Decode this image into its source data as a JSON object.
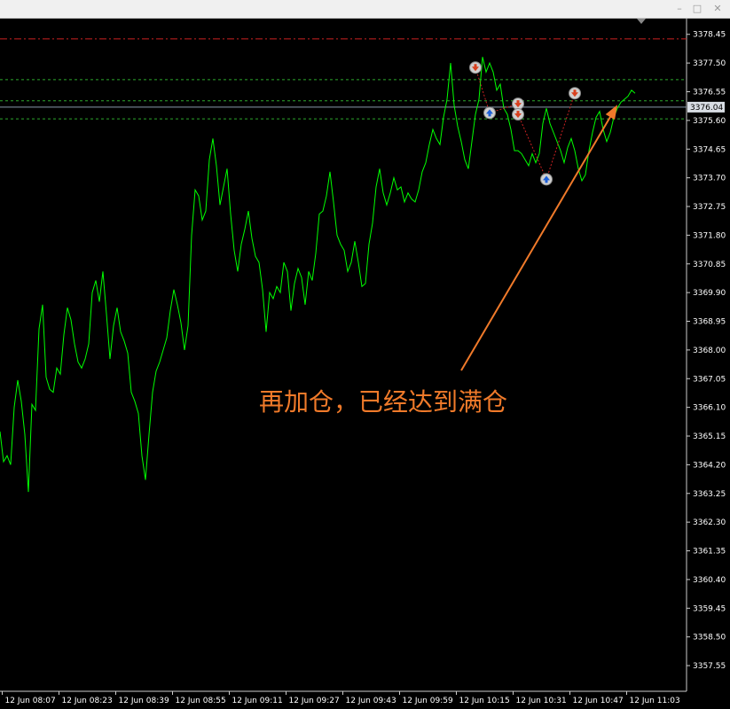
{
  "window": {
    "minimize_glyph": "–",
    "maximize_glyph": "□",
    "close_glyph": "✕"
  },
  "chart_data": {
    "type": "line",
    "title": "",
    "xlabel": "",
    "ylabel": "",
    "ylim": [
      3356.7,
      3379.0
    ],
    "y_ticks": [
      "3378.45",
      "3377.50",
      "3376.55",
      "3375.60",
      "3374.65",
      "3373.70",
      "3372.75",
      "3371.80",
      "3370.85",
      "3369.90",
      "3368.95",
      "3368.00",
      "3367.05",
      "3366.10",
      "3365.15",
      "3364.20",
      "3363.25",
      "3362.30",
      "3361.35",
      "3360.40",
      "3359.45",
      "3358.50",
      "3357.55"
    ],
    "x_ticks": [
      "12 Jun 08:07",
      "12 Jun 08:23",
      "12 Jun 08:39",
      "12 Jun 08:55",
      "12 Jun 09:11",
      "12 Jun 09:27",
      "12 Jun 09:43",
      "12 Jun 09:59",
      "12 Jun 10:15",
      "12 Jun 10:31",
      "12 Jun 10:47",
      "12 Jun 11:03"
    ],
    "current_price": "3376.04",
    "colors": {
      "line": "#00ff00",
      "level": "#2ea82e",
      "stop_level": "#cc2222",
      "arrow": "#f07a2a",
      "text": "#ffffff"
    },
    "levels": [
      {
        "price": 3378.3,
        "style": "dash-dot",
        "color": "#cc2222"
      },
      {
        "price": 3376.95,
        "style": "dashed",
        "color": "#2ea82e"
      },
      {
        "price": 3376.25,
        "style": "dashed",
        "color": "#2ea82e"
      },
      {
        "price": 3375.65,
        "style": "dashed",
        "color": "#2ea82e"
      }
    ],
    "series": [
      {
        "x_index": [
          0,
          1,
          2,
          3,
          4,
          5,
          6,
          7,
          8,
          9,
          10,
          11,
          12,
          13,
          14,
          15,
          16,
          17,
          18,
          19,
          20,
          21,
          22,
          23,
          24,
          25,
          26,
          27,
          28,
          29,
          30,
          31,
          32,
          33,
          34,
          35,
          36,
          37,
          38,
          39,
          40,
          41,
          42,
          43,
          44,
          45,
          46,
          47,
          48,
          49,
          50,
          51,
          52,
          53,
          54,
          55,
          56,
          57,
          58,
          59,
          60,
          61,
          62,
          63,
          64,
          65,
          66,
          67,
          68,
          69,
          70,
          71,
          72,
          73,
          74,
          75,
          76,
          77,
          78,
          79,
          80,
          81,
          82,
          83,
          84,
          85,
          86,
          87,
          88,
          89,
          90,
          91,
          92,
          93,
          94,
          95,
          96,
          97,
          98,
          99,
          100,
          101,
          102,
          103,
          104,
          105,
          106,
          107,
          108,
          109,
          110,
          111,
          112,
          113,
          114,
          115,
          116,
          117,
          118,
          119,
          120,
          121,
          122,
          123,
          124,
          125,
          126,
          127,
          128,
          129,
          130,
          131,
          132,
          133,
          134,
          135,
          136,
          137,
          138,
          139,
          140,
          141,
          142,
          143,
          144,
          145,
          146,
          147,
          148,
          149,
          150,
          151,
          152,
          153,
          154,
          155,
          156,
          157,
          158,
          159,
          160,
          161,
          162,
          163,
          164,
          165,
          166,
          167,
          168,
          169,
          170,
          171,
          172,
          173,
          174,
          175,
          176,
          177,
          178,
          179
        ],
        "values": [
          3365.3,
          3364.3,
          3364.5,
          3364.2,
          3366.1,
          3367.0,
          3366.3,
          3365.2,
          3363.3,
          3366.2,
          3366.0,
          3368.7,
          3369.5,
          3367.1,
          3366.7,
          3366.6,
          3367.4,
          3367.2,
          3368.5,
          3369.4,
          3369.0,
          3368.2,
          3367.6,
          3367.4,
          3367.7,
          3368.2,
          3369.9,
          3370.3,
          3369.6,
          3370.6,
          3369.2,
          3367.7,
          3368.8,
          3369.4,
          3368.6,
          3368.3,
          3367.9,
          3366.6,
          3366.3,
          3365.9,
          3364.5,
          3363.7,
          3365.2,
          3366.6,
          3367.3,
          3367.6,
          3368.0,
          3368.4,
          3369.3,
          3370.0,
          3369.5,
          3368.9,
          3368.0,
          3368.8,
          3371.8,
          3373.3,
          3373.1,
          3372.3,
          3372.6,
          3374.3,
          3375.0,
          3374.1,
          3372.8,
          3373.4,
          3374.0,
          3372.5,
          3371.3,
          3370.6,
          3371.5,
          3372.0,
          3372.6,
          3371.7,
          3371.1,
          3370.9,
          3370.0,
          3368.6,
          3369.9,
          3369.7,
          3370.1,
          3369.9,
          3370.9,
          3370.6,
          3369.3,
          3370.2,
          3370.7,
          3370.4,
          3369.5,
          3370.6,
          3370.3,
          3371.2,
          3372.5,
          3372.6,
          3373.1,
          3373.9,
          3372.9,
          3371.8,
          3371.5,
          3371.3,
          3370.6,
          3370.9,
          3371.6,
          3370.9,
          3370.1,
          3370.2,
          3371.5,
          3372.2,
          3373.4,
          3374.0,
          3373.2,
          3372.8,
          3373.2,
          3373.7,
          3373.3,
          3373.4,
          3372.9,
          3373.2,
          3373.0,
          3372.9,
          3373.3,
          3373.9,
          3374.2,
          3374.8,
          3375.3,
          3375.0,
          3374.8,
          3375.7,
          3376.3,
          3377.5,
          3376.1,
          3375.4,
          3374.9,
          3374.3,
          3374.0,
          3374.9,
          3375.8,
          3376.3,
          3377.7,
          3377.2,
          3377.5,
          3377.2,
          3376.6,
          3376.8,
          3376.0,
          3375.8,
          3375.3,
          3374.6,
          3374.6,
          3374.5,
          3374.3,
          3374.1,
          3374.5,
          3374.2,
          3374.5,
          3375.5,
          3376.0,
          3375.5,
          3375.2,
          3374.9,
          3374.6,
          3374.2,
          3374.7,
          3375.0,
          3374.6,
          3374.0,
          3373.6,
          3373.8,
          3374.6,
          3375.2,
          3375.7,
          3375.9,
          3375.3,
          3374.9,
          3375.2,
          3375.7,
          3376.0,
          3376.2,
          3376.3,
          3376.4,
          3376.6,
          3376.5,
          3376.4,
          3376.4,
          3376.4,
          3376.4,
          3376.3,
          3376.3
        ]
      }
    ],
    "trade_markers": [
      {
        "x_index": 134,
        "price": 3377.35,
        "side": "sell"
      },
      {
        "x_index": 138,
        "price": 3375.85,
        "side": "buy"
      },
      {
        "x_index": 146,
        "price": 3376.15,
        "side": "sell"
      },
      {
        "x_index": 146,
        "price": 3375.8,
        "side": "sell"
      },
      {
        "x_index": 154,
        "price": 3373.65,
        "side": "buy"
      },
      {
        "x_index": 162,
        "price": 3376.5,
        "side": "sell"
      }
    ],
    "annotation": {
      "text": "再加仓，已经达到满仓"
    }
  }
}
